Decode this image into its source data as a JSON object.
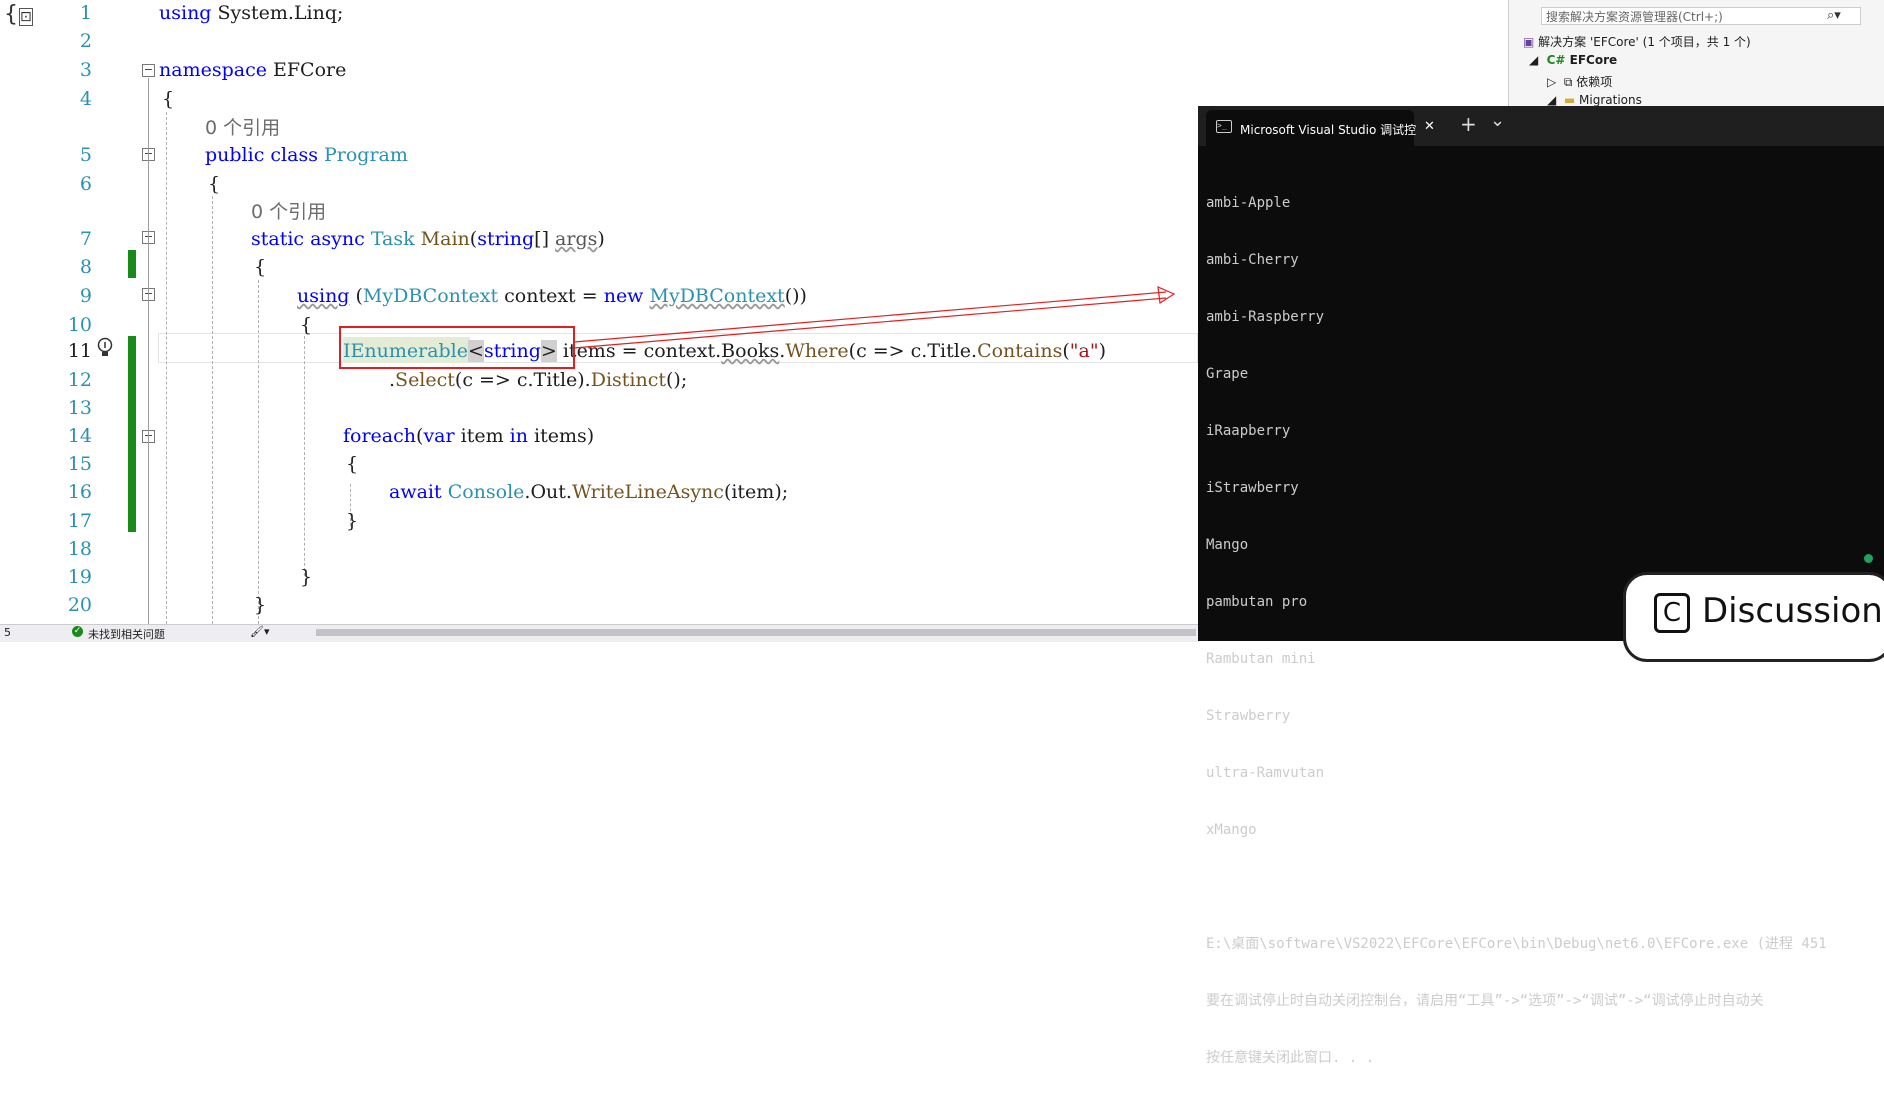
{
  "editor": {
    "line_numbers": [
      "1",
      "2",
      "3",
      "4",
      "5",
      "6",
      "7",
      "8",
      "9",
      "10",
      "11",
      "12",
      "13",
      "14",
      "15",
      "16",
      "17",
      "18",
      "19",
      "20"
    ],
    "lines": {
      "l1_kw": "using",
      "l1_rest": " System.Linq;",
      "l3_kw": "namespace",
      "l3_rest": " EFCore",
      "l4": "{",
      "ref1": "0 个引用",
      "l5_kw": "public class",
      "l5_ty": " Program",
      "l6": "{",
      "ref2": "0 个引用",
      "l7_kw": "static async",
      "l7_ty": " Task",
      "l7_mt": " Main",
      "l7_p1": "(",
      "l7_kw2": "string",
      "l7_p2": "[] ",
      "l7_args": "args",
      "l7_p3": ")",
      "l8": "{",
      "l9_kw": "using",
      "l9_p1": " (",
      "l9_ty": "MyDBContext",
      "l9_p2": " context = ",
      "l9_kw2": "new",
      "l9_sp": " ",
      "l9_ty2": "MyDBContext",
      "l9_p3": "())",
      "l10": "{",
      "l11_ty": "IEnumerable",
      "l11_lt": "<",
      "l11_kw": "string",
      "l11_gt": ">",
      "l11_p1": " items = context.",
      "l11_books": "Books",
      "l11_dot": ".",
      "l11_mt": "Where",
      "l11_p2": "(c => c.Title.",
      "l11_mt2": "Contains",
      "l11_p3": "(",
      "l11_st": "\"a\"",
      "l11_p4": ")",
      "l12_p1": ".",
      "l12_mt": "Select",
      "l12_p2": "(c => c.Title).",
      "l12_mt2": "Distinct",
      "l12_p3": "();",
      "l14_kw": "foreach",
      "l14_p1": "(",
      "l14_kw2": "var",
      "l14_p2": " item ",
      "l14_kw3": "in",
      "l14_p3": " items)",
      "l15": "{",
      "l16_kw": "await",
      "l16_sp": " ",
      "l16_ty": "Console",
      "l16_p1": ".Out.",
      "l16_mt": "WriteLineAsync",
      "l16_p2": "(item);",
      "l17": "}",
      "l19": "}",
      "l20": "}"
    },
    "top_left_glyph": "{",
    "top_left_box": "⊡"
  },
  "statusbar": {
    "zoom": "5",
    "issues": "未找到相关问题"
  },
  "solution_explorer": {
    "search_placeholder": "搜索解决方案资源管理器(Ctrl+;)",
    "solution": "解决方案 'EFCore' (1 个项目，共 1 个)",
    "project": "EFCore",
    "deps": "依赖项",
    "migrations": "Migrations"
  },
  "terminal": {
    "tab_title": "Microsoft Visual Studio 调试控",
    "close": "✕",
    "new_tab": "+",
    "dropdown": "⌄",
    "output_lines": [
      "ambi-Apple",
      "ambi-Cherry",
      "ambi-Raspberry",
      "Grape",
      "iRaapberry",
      "iStrawberry",
      "Mango",
      "pambutan pro",
      "Rambutan mini",
      "Strawberry",
      "ultra-Ramvutan",
      "xMango",
      "",
      "E:\\桌面\\software\\VS2022\\EFCore\\EFCore\\bin\\Debug\\net6.0\\EFCore.exe (进程 451",
      "要在调试停止时自动关闭控制台，请启用“工具”->“选项”->“调试”->“调试停止时自动关",
      "按任意键关闭此窗口. . ."
    ]
  },
  "watermark": {
    "text": "Discussion",
    "icon": "C"
  },
  "colors": {
    "keyword": "#0000ff",
    "type": "#2b91af",
    "method": "#74531f",
    "string": "#a31515",
    "change_bar": "#1a8a1a",
    "annotation": "#e02020",
    "terminal_bg": "#0c0c0c"
  }
}
